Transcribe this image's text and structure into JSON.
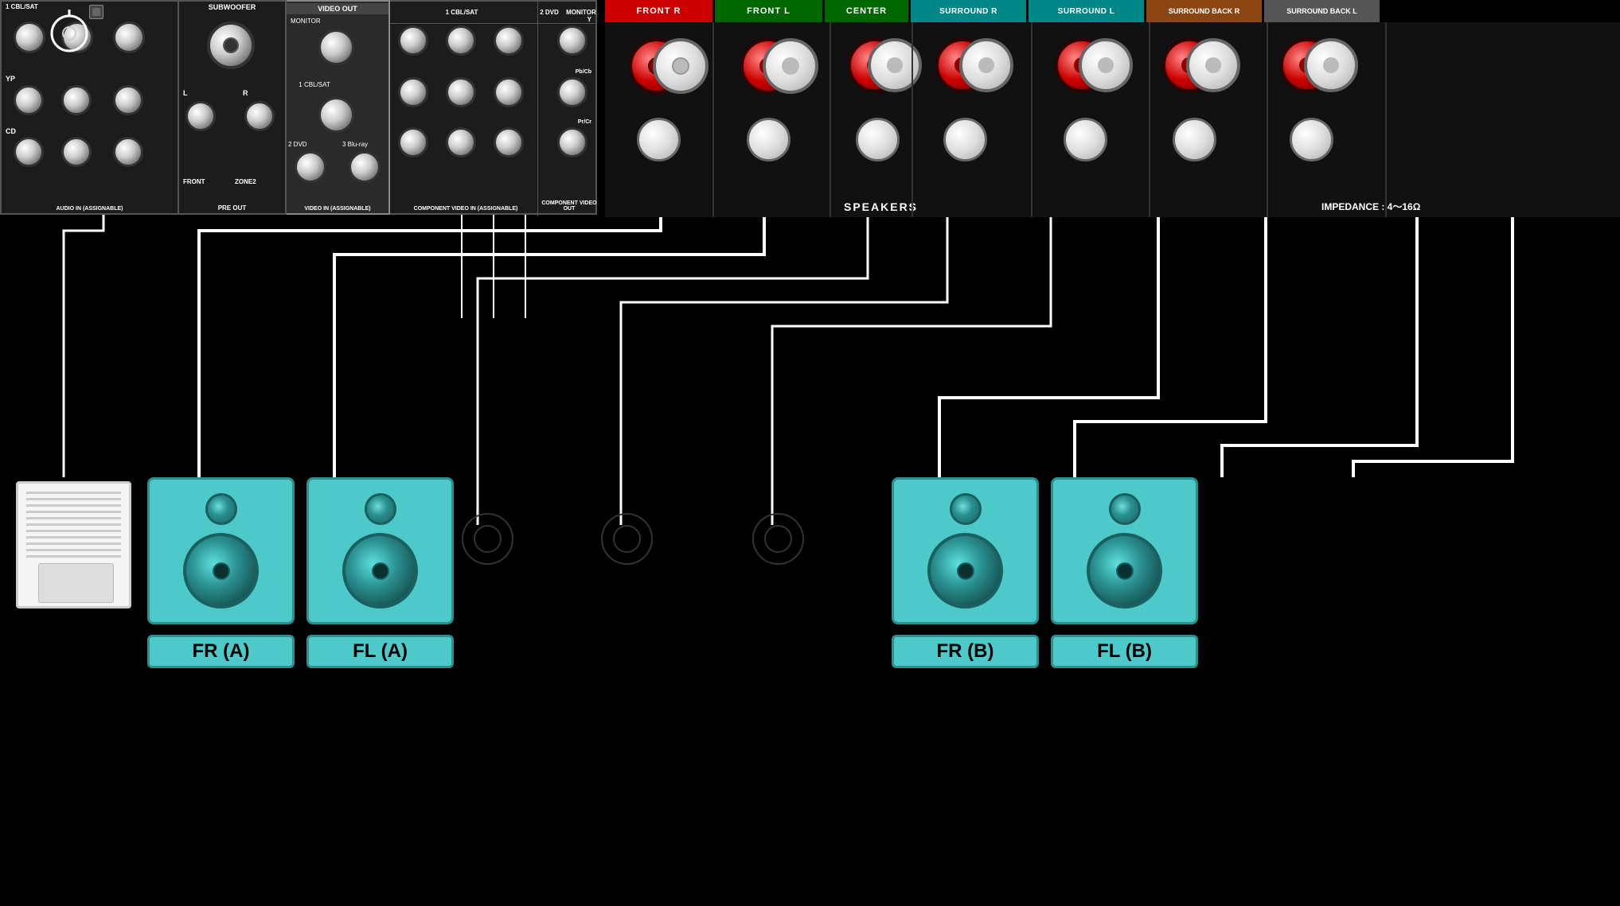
{
  "terminals": {
    "front_r": {
      "label": "FRONT R",
      "color": "#cc0000"
    },
    "front_l": {
      "label": "FRONT L",
      "color": "#006600"
    },
    "center": {
      "label": "CENTER",
      "color": "#006600"
    },
    "surround_r": {
      "label": "SURROUND R",
      "color": "#009999"
    },
    "surround_l": {
      "label": "SURROUND L",
      "color": "#009999"
    },
    "surround_back_r": {
      "label": "SURROUND BACK R",
      "color": "#8B4513"
    },
    "surround_back_l": {
      "label": "SURROUND BACK L",
      "color": "#555555"
    }
  },
  "sections": {
    "subwoofer": "SUBWOOFER",
    "video_out": "VIDEO OUT",
    "audio_in": "AUDIO IN (ASSIGNABLE)",
    "pre_out": "PRE OUT",
    "video_in": "VIDEO IN (ASSIGNABLE)",
    "component_video_in": "COMPONENT VIDEO IN (ASSIGNABLE)",
    "component_video_out": "COMPONENT VIDEO OUT",
    "speakers": "SPEAKERS",
    "impedance": "IMPEDANCE : 4～16Ω"
  },
  "inputs": {
    "cbl_sat_1": "1 CBL/SAT",
    "cbl_sat_2": "1 CBL/SAT",
    "dvd": "2 DVD",
    "monitor": "MONITOR",
    "yp": "YP",
    "cd": "CD",
    "front": "FRONT",
    "zone2": "ZONE2",
    "cbl_sat_video": "1 CBL/SAT",
    "dvd_video": "2 DVD",
    "blu_ray": "3 Blu-ray",
    "monitor_video": "MONITOR",
    "y": "Y",
    "pb_cb": "Pb/Cb",
    "pr_cr": "Pr/Cr"
  },
  "speakers": {
    "fr_a": {
      "label": "FR (A)",
      "color": "#4dc9c9"
    },
    "fl_a": {
      "label": "FL (A)",
      "color": "#4dc9c9"
    },
    "fr_b": {
      "label": "FR (B)",
      "color": "#4dc9c9"
    },
    "fl_b": {
      "label": "FL (B)",
      "color": "#4dc9c9"
    }
  }
}
